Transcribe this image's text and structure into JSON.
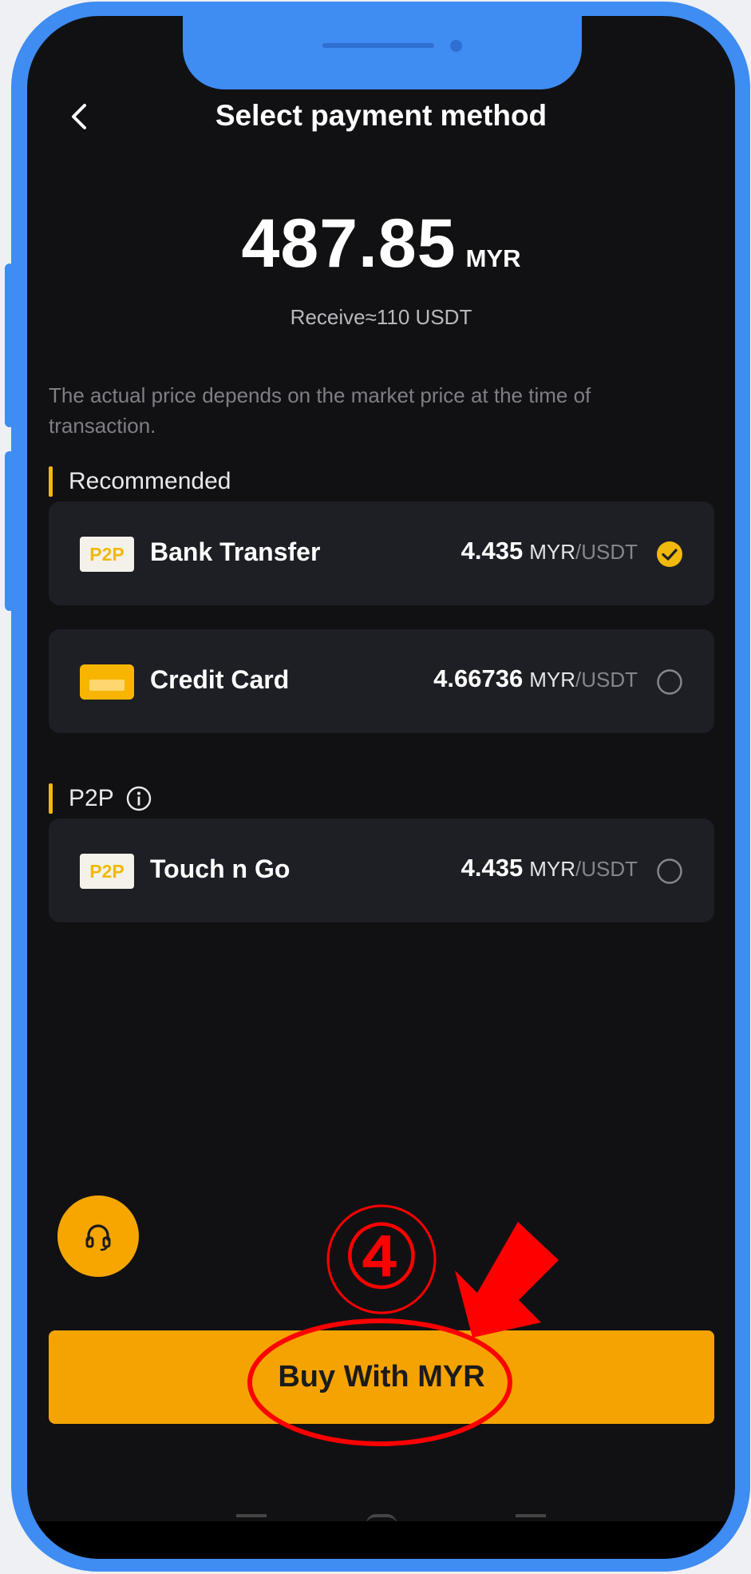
{
  "header": {
    "title": "Select payment method",
    "back_icon": "chevron-left-icon"
  },
  "amount": {
    "value": "487.85",
    "unit": "MYR",
    "receive": "Receive≈110 USDT"
  },
  "note": "The actual price depends on the market price at the time of transaction.",
  "sections": {
    "recommended": "Recommended",
    "p2p": "P2P"
  },
  "methods": [
    {
      "badge": "P2P",
      "name": "Bank Transfer",
      "rate": "4.435",
      "currency": "MYR",
      "separator": "/",
      "base": "USDT",
      "selected": true,
      "icon": "p2p-badge-icon"
    },
    {
      "badge": "",
      "name": "Credit Card",
      "rate": "4.66736",
      "currency": "MYR",
      "separator": "/",
      "base": "USDT",
      "selected": false,
      "icon": "credit-card-icon"
    },
    {
      "badge": "P2P",
      "name": "Touch n Go",
      "rate": "4.435",
      "currency": "MYR",
      "separator": "/",
      "base": "USDT",
      "selected": false,
      "icon": "p2p-badge-icon"
    }
  ],
  "buy_button": "Buy With MYR",
  "annotation": {
    "step": "④",
    "color": "#ff0000"
  },
  "colors": {
    "accent": "#f5a300",
    "background": "#111114",
    "card": "#1e1f25",
    "frame": "#3f8cf2"
  }
}
